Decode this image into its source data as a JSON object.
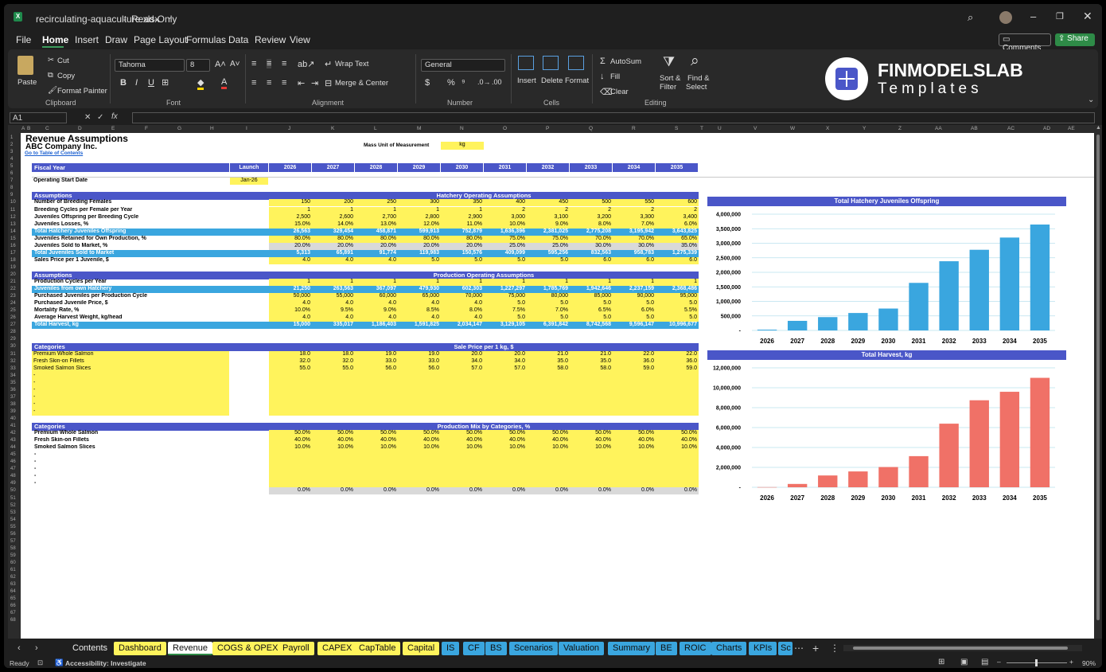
{
  "titlebar": {
    "filename": "recirculating-aquaculture.xlsx",
    "mode": "Read-Only"
  },
  "menu": [
    "File",
    "Home",
    "Insert",
    "Draw",
    "Page Layout",
    "Formulas",
    "Data",
    "Review",
    "View"
  ],
  "menu_active": "Home",
  "share": {
    "comments": "Comments",
    "share": "Share"
  },
  "ribbon": {
    "clipboard": {
      "paste": "Paste",
      "cut": "Cut",
      "copy": "Copy",
      "format_painter": "Format Painter",
      "label": "Clipboard"
    },
    "font": {
      "name": "Tahoma",
      "size": "8",
      "label": "Font"
    },
    "alignment": {
      "wrap": "Wrap Text",
      "merge": "Merge & Center",
      "label": "Alignment"
    },
    "number": {
      "format": "General",
      "label": "Number"
    },
    "cells": {
      "insert": "Insert",
      "delete": "Delete",
      "format": "Format",
      "label": "Cells"
    },
    "editing": {
      "autosum": "AutoSum",
      "fill": "Fill",
      "clear": "Clear",
      "sort": "Sort &",
      "sort2": "Filter",
      "find": "Find &",
      "find2": "Select",
      "label": "Editing"
    },
    "logo": {
      "line1": "FINMODELSLAB",
      "line2": "Templates"
    }
  },
  "formula_bar": {
    "name_box": "A1",
    "formula": ""
  },
  "columns": [
    "A",
    "B",
    "C",
    "D",
    "E",
    "F",
    "G",
    "H",
    "I",
    "J",
    "K",
    "L",
    "M",
    "N",
    "O",
    "P",
    "Q",
    "R",
    "S",
    "T",
    "U",
    "V",
    "W",
    "X",
    "Y",
    "Z",
    "AA",
    "AB",
    "AC",
    "AD",
    "AE"
  ],
  "sheet": {
    "title": "Revenue Assumptions",
    "company": "ABC Company Inc.",
    "toc": "Go to Table of Contents",
    "mass_unit_label": "Mass Unit of Measurement",
    "mass_unit": "kg",
    "fiscal_year": "Fiscal Year",
    "launch": "Launch",
    "years": [
      "2026",
      "2027",
      "2028",
      "2029",
      "2030",
      "2031",
      "2032",
      "2033",
      "2034",
      "2035"
    ],
    "start_date_label": "Operating Start Date",
    "start_date": "Jan-26",
    "assumptions": "Assumptions",
    "hatchery_title": "Hatchery Operating Assumptions",
    "hatchery_rows": [
      {
        "label": "Number of Breeding Females",
        "values": [
          "150",
          "200",
          "250",
          "300",
          "350",
          "400",
          "450",
          "500",
          "550",
          "600"
        ],
        "style": "yl"
      },
      {
        "label": "Breeding Cycles per Female per Year",
        "values": [
          "1",
          "1",
          "1",
          "1",
          "1",
          "2",
          "2",
          "2",
          "2",
          "2"
        ],
        "style": "yl"
      },
      {
        "label": "Juveniles Offspring per Breeding Cycle",
        "values": [
          "2,500",
          "2,600",
          "2,700",
          "2,800",
          "2,900",
          "3,000",
          "3,100",
          "3,200",
          "3,300",
          "3,400"
        ],
        "style": "yl"
      },
      {
        "label": "Juveniles Losses, %",
        "values": [
          "15.0%",
          "14.0%",
          "13.0%",
          "12.0%",
          "11.0%",
          "10.0%",
          "9.0%",
          "8.0%",
          "7.0%",
          "6.0%"
        ],
        "style": "yl"
      },
      {
        "label": "Total Hatchery Juveniles Offspring",
        "values": [
          "26,563",
          "329,454",
          "458,871",
          "599,913",
          "752,879",
          "1,636,396",
          "2,381,025",
          "2,775,208",
          "3,195,942",
          "3,643,825"
        ],
        "style": "lb"
      }
    ],
    "hatchery_rows2": [
      {
        "label": "Juveniles Retained for Own Production, %",
        "values": [
          "80.0%",
          "80.0%",
          "80.0%",
          "80.0%",
          "80.0%",
          "75.0%",
          "75.0%",
          "70.0%",
          "70.0%",
          "65.0%"
        ],
        "style": "yl"
      },
      {
        "label": "Juveniles Sold to Market, %",
        "values": [
          "20.0%",
          "20.0%",
          "20.0%",
          "20.0%",
          "20.0%",
          "25.0%",
          "25.0%",
          "30.0%",
          "30.0%",
          "35.0%"
        ],
        "style": "gr"
      },
      {
        "label": "Total Juveniles Sold to Market",
        "values": [
          "5,313",
          "65,891",
          "91,774",
          "119,983",
          "150,576",
          "409,099",
          "595,256",
          "832,563",
          "958,783",
          "1,275,339"
        ],
        "style": "lb"
      },
      {
        "label": "Sales Price per 1 Juvenile, $",
        "values": [
          "4.0",
          "4.0",
          "4.0",
          "5.0",
          "5.0",
          "5.0",
          "5.0",
          "6.0",
          "6.0",
          "6.0"
        ],
        "style": "yl"
      }
    ],
    "production_title": "Production Operating Assumptions",
    "production_rows": [
      {
        "label": "Production Cycles per Year",
        "values": [
          "1",
          "1",
          "1",
          "1",
          "1",
          "1",
          "1",
          "1",
          "1",
          "1"
        ],
        "style": "yl"
      },
      {
        "label": "Juveniles from own Hatchery",
        "values": [
          "21,250",
          "263,563",
          "367,097",
          "479,930",
          "602,303",
          "1,227,297",
          "1,785,769",
          "1,942,646",
          "2,237,159",
          "2,368,486"
        ],
        "style": "lb"
      },
      {
        "label": "Purchased Juveniles per Production Cycle",
        "values": [
          "50,000",
          "55,000",
          "60,000",
          "65,000",
          "70,000",
          "75,000",
          "80,000",
          "85,000",
          "90,000",
          "95,000"
        ],
        "style": "yl"
      },
      {
        "label": "Purchased Juvenile Price, $",
        "values": [
          "4.0",
          "4.0",
          "4.0",
          "4.0",
          "4.0",
          "5.0",
          "5.0",
          "5.0",
          "5.0",
          "5.0"
        ],
        "style": "yl"
      },
      {
        "label": "Mortality Rate, %",
        "values": [
          "10.0%",
          "9.5%",
          "9.0%",
          "8.5%",
          "8.0%",
          "7.5%",
          "7.0%",
          "6.5%",
          "6.0%",
          "5.5%"
        ],
        "style": "yl"
      },
      {
        "label": "Average Harvest Weight, kg/head",
        "values": [
          "4.0",
          "4.0",
          "4.0",
          "4.0",
          "4.0",
          "5.0",
          "5.0",
          "5.0",
          "5.0",
          "5.0"
        ],
        "style": "yl"
      },
      {
        "label": "Total Harvest, kg",
        "values": [
          "15,000",
          "335,017",
          "1,186,403",
          "1,591,825",
          "2,034,147",
          "3,129,105",
          "6,391,842",
          "8,742,568",
          "9,596,147",
          "10,996,677"
        ],
        "style": "lb"
      }
    ],
    "categories": "Categories",
    "price_title": "Sale Price per 1 kg, $",
    "price_rows": [
      {
        "label": "Premium Whole Salmon",
        "values": [
          "18.0",
          "18.0",
          "19.0",
          "19.0",
          "20.0",
          "20.0",
          "21.0",
          "21.0",
          "22.0",
          "22.0"
        ]
      },
      {
        "label": "Fresh Skin-on Fillets",
        "values": [
          "32.0",
          "32.0",
          "33.0",
          "33.0",
          "34.0",
          "34.0",
          "35.0",
          "35.0",
          "36.0",
          "36.0"
        ]
      },
      {
        "label": "Smoked Salmon Slices",
        "values": [
          "55.0",
          "55.0",
          "56.0",
          "56.0",
          "57.0",
          "57.0",
          "58.0",
          "58.0",
          "59.0",
          "59.0"
        ]
      },
      {
        "label": "-",
        "values": [
          "",
          "",
          "",
          "",
          "",
          "",
          "",
          "",
          "",
          ""
        ]
      },
      {
        "label": "-",
        "values": [
          "",
          "",
          "",
          "",
          "",
          "",
          "",
          "",
          "",
          ""
        ]
      },
      {
        "label": "-",
        "values": [
          "",
          "",
          "",
          "",
          "",
          "",
          "",
          "",
          "",
          ""
        ]
      },
      {
        "label": "-",
        "values": [
          "",
          "",
          "",
          "",
          "",
          "",
          "",
          "",
          "",
          ""
        ]
      },
      {
        "label": "-",
        "values": [
          "",
          "",
          "",
          "",
          "",
          "",
          "",
          "",
          "",
          ""
        ]
      },
      {
        "label": "-",
        "values": [
          "",
          "",
          "",
          "",
          "",
          "",
          "",
          "",
          "",
          ""
        ]
      }
    ],
    "mix_title": "Production Mix by Categories, %",
    "mix_rows": [
      {
        "label": "Premium Whole Salmon",
        "values": [
          "50.0%",
          "50.0%",
          "50.0%",
          "50.0%",
          "50.0%",
          "50.0%",
          "50.0%",
          "50.0%",
          "50.0%",
          "50.0%"
        ],
        "style": "yl"
      },
      {
        "label": "Fresh Skin-on Fillets",
        "values": [
          "40.0%",
          "40.0%",
          "40.0%",
          "40.0%",
          "40.0%",
          "40.0%",
          "40.0%",
          "40.0%",
          "40.0%",
          "40.0%"
        ],
        "style": "yl"
      },
      {
        "label": "Smoked Salmon Slices",
        "values": [
          "10.0%",
          "10.0%",
          "10.0%",
          "10.0%",
          "10.0%",
          "10.0%",
          "10.0%",
          "10.0%",
          "10.0%",
          "10.0%"
        ],
        "style": "yl"
      },
      {
        "label": "-",
        "values": [
          "",
          "",
          "",
          "",
          "",
          "",
          "",
          "",
          "",
          ""
        ],
        "style": "yl"
      },
      {
        "label": "-",
        "values": [
          "",
          "",
          "",
          "",
          "",
          "",
          "",
          "",
          "",
          ""
        ],
        "style": "yl"
      },
      {
        "label": "-",
        "values": [
          "",
          "",
          "",
          "",
          "",
          "",
          "",
          "",
          "",
          ""
        ],
        "style": "yl"
      },
      {
        "label": "-",
        "values": [
          "",
          "",
          "",
          "",
          "",
          "",
          "",
          "",
          "",
          ""
        ],
        "style": "yl"
      },
      {
        "label": "-",
        "values": [
          "",
          "",
          "",
          "",
          "",
          "",
          "",
          "",
          "",
          ""
        ],
        "style": "yl"
      },
      {
        "label": "",
        "values": [
          "0.0%",
          "0.0%",
          "0.0%",
          "0.0%",
          "0.0%",
          "0.0%",
          "0.0%",
          "0.0%",
          "0.0%",
          "0.0%"
        ],
        "style": "gr"
      }
    ]
  },
  "chart_data": [
    {
      "type": "bar",
      "title": "Total Hatchery Juveniles Offspring",
      "categories": [
        "2026",
        "2027",
        "2028",
        "2029",
        "2030",
        "2031",
        "2032",
        "2033",
        "2034",
        "2035"
      ],
      "values": [
        26563,
        329454,
        458871,
        599913,
        752879,
        1636396,
        2381025,
        2775208,
        3195942,
        3643825
      ],
      "ylim": [
        0,
        4000000
      ],
      "yticks": [
        "4,000,000",
        "3,500,000",
        "3,000,000",
        "2,500,000",
        "2,000,000",
        "1,500,000",
        "1,000,000",
        "500,000",
        "-"
      ],
      "color": "#3aa6df"
    },
    {
      "type": "bar",
      "title": "Total Harvest, kg",
      "categories": [
        "2026",
        "2027",
        "2028",
        "2029",
        "2030",
        "2031",
        "2032",
        "2033",
        "2034",
        "2035"
      ],
      "values": [
        15000,
        335017,
        1186403,
        1591825,
        2034147,
        3129105,
        6391842,
        8742568,
        9596147,
        10996677
      ],
      "ylim": [
        0,
        12000000
      ],
      "yticks": [
        "12,000,000",
        "10,000,000",
        "8,000,000",
        "6,000,000",
        "4,000,000",
        "2,000,000",
        "-"
      ],
      "color": "#f07167"
    }
  ],
  "tabs": [
    {
      "label": "Contents",
      "color": ""
    },
    {
      "label": "Dashboard",
      "color": "#fff35c"
    },
    {
      "label": "Revenue",
      "color": "#fff35c",
      "active": true
    },
    {
      "label": "COGS & OPEX",
      "color": "#fff35c"
    },
    {
      "label": "Payroll",
      "color": "#fff35c"
    },
    {
      "label": "CAPEX",
      "color": "#fff35c"
    },
    {
      "label": "CapTable",
      "color": "#fff35c"
    },
    {
      "label": "Capital",
      "color": "#fff35c"
    },
    {
      "label": "IS",
      "color": "#3aa6df"
    },
    {
      "label": "CF",
      "color": "#3aa6df"
    },
    {
      "label": "BS",
      "color": "#3aa6df"
    },
    {
      "label": "Scenarios",
      "color": "#3aa6df"
    },
    {
      "label": "Valuation",
      "color": "#3aa6df"
    },
    {
      "label": "Summary",
      "color": "#3aa6df"
    },
    {
      "label": "BE",
      "color": "#3aa6df"
    },
    {
      "label": "ROIC",
      "color": "#3aa6df"
    },
    {
      "label": "Charts",
      "color": "#3aa6df"
    },
    {
      "label": "KPIs",
      "color": "#3aa6df"
    },
    {
      "label": "Sc",
      "color": "#3aa6df"
    }
  ],
  "status": {
    "ready": "Ready",
    "accessibility": "Accessibility: Investigate",
    "zoom": "90%"
  }
}
